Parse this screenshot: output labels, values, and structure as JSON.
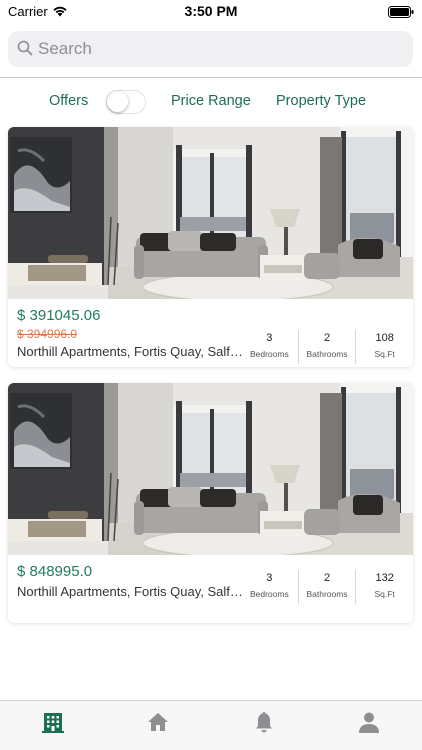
{
  "status_bar": {
    "carrier": "Carrier",
    "time": "3:50 PM",
    "wifi_icon": "wifi-icon",
    "battery_icon": "battery-icon"
  },
  "search": {
    "placeholder": "Search",
    "value": "",
    "icon": "search-icon"
  },
  "filters": {
    "offers_label": "Offers",
    "offers_enabled": false,
    "price_range_label": "Price Range",
    "property_type_label": "Property Type"
  },
  "listings": [
    {
      "price": "$ 391045.06",
      "old_price": "$ 394996.0",
      "address": "Northill Apartments, Fortis Quay, Salford",
      "bedrooms": "3",
      "bedrooms_label": "Bedrooms",
      "bathrooms": "2",
      "bathrooms_label": "Bathrooms",
      "area": "108",
      "area_label": "Sq.Ft"
    },
    {
      "price": "$ 848995.0",
      "address": "Northill Apartments, Fortis Quay, Salford",
      "bedrooms": "3",
      "bedrooms_label": "Bedrooms",
      "bathrooms": "2",
      "bathrooms_label": "Bathrooms",
      "area": "132",
      "area_label": "Sq.Ft"
    }
  ],
  "tab_bar": {
    "items": [
      {
        "icon": "building-icon",
        "active": true
      },
      {
        "icon": "home-icon",
        "active": false
      },
      {
        "icon": "bell-icon",
        "active": false
      },
      {
        "icon": "user-icon",
        "active": false
      }
    ]
  },
  "colors": {
    "accent": "#1e6e54",
    "price": "#1e7e5e",
    "old_price": "#e0784a",
    "tab_inactive": "#8e8e93"
  }
}
